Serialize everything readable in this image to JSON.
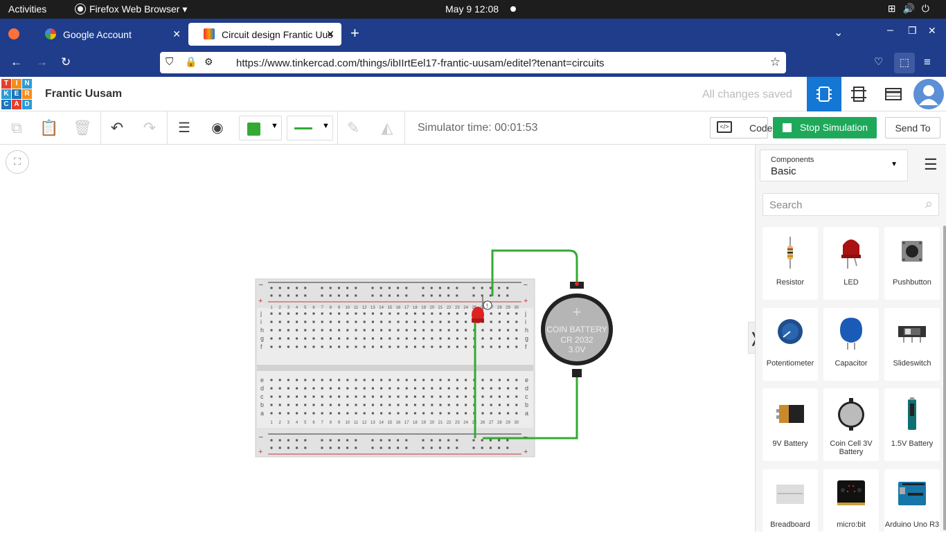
{
  "os": {
    "activities": "Activities",
    "app_menu": "Firefox Web Browser ▾",
    "clock": "May 9  12:08"
  },
  "browser": {
    "tabs": [
      {
        "label": "Google Account"
      },
      {
        "label": "Circuit design Frantic Uus"
      }
    ],
    "url": "https://www.tinkercad.com/things/ibIIrtEel17-frantic-uusam/editel?tenant=circuits"
  },
  "app": {
    "logo_letters": [
      "T",
      "I",
      "N",
      "K",
      "E",
      "R",
      "C",
      "A",
      "D"
    ],
    "project_name": "Frantic Uusam",
    "save_status": "All changes saved"
  },
  "toolbar": {
    "simulator_time": "Simulator time: 00:01:53",
    "code_label": "Code",
    "stop_label": "Stop Simulation",
    "send_label": "Send To",
    "wire_color": "#33aa33"
  },
  "panel": {
    "components_label": "Components",
    "components_value": "Basic",
    "search_placeholder": "Search",
    "items": [
      {
        "label": "Resistor"
      },
      {
        "label": "LED"
      },
      {
        "label": "Pushbutton"
      },
      {
        "label": "Potentiometer"
      },
      {
        "label": "Capacitor"
      },
      {
        "label": "Slideswitch"
      },
      {
        "label": "9V Battery"
      },
      {
        "label": "Coin Cell 3V Battery"
      },
      {
        "label": "1.5V Battery"
      },
      {
        "label": "Breadboard"
      },
      {
        "label": "micro:bit"
      },
      {
        "label": "Arduino Uno R3"
      }
    ]
  },
  "circuit": {
    "battery_line1": "COIN BATTERY",
    "battery_line2": "CR 2032",
    "battery_line3": "3.0V",
    "battery_plus": "+",
    "warning_mark": "!",
    "rail_minus": "–",
    "rail_plus": "+",
    "row_labels_top": [
      "j",
      "i",
      "h",
      "g",
      "f"
    ],
    "row_labels_bottom": [
      "e",
      "d",
      "c",
      "b",
      "a"
    ],
    "column_numbers": [
      "1",
      "2",
      "3",
      "4",
      "5",
      "6",
      "7",
      "8",
      "9",
      "10",
      "11",
      "12",
      "13",
      "14",
      "15",
      "16",
      "17",
      "18",
      "19",
      "20",
      "21",
      "22",
      "23",
      "24",
      "25",
      "26",
      "27",
      "28",
      "29",
      "30"
    ]
  },
  "colors": {
    "tab_bar": "#1f3d8a",
    "accent_blue": "#1477d4",
    "stop_green": "#1ea95a",
    "wire_green": "#33aa33",
    "led_red": "#d22"
  }
}
